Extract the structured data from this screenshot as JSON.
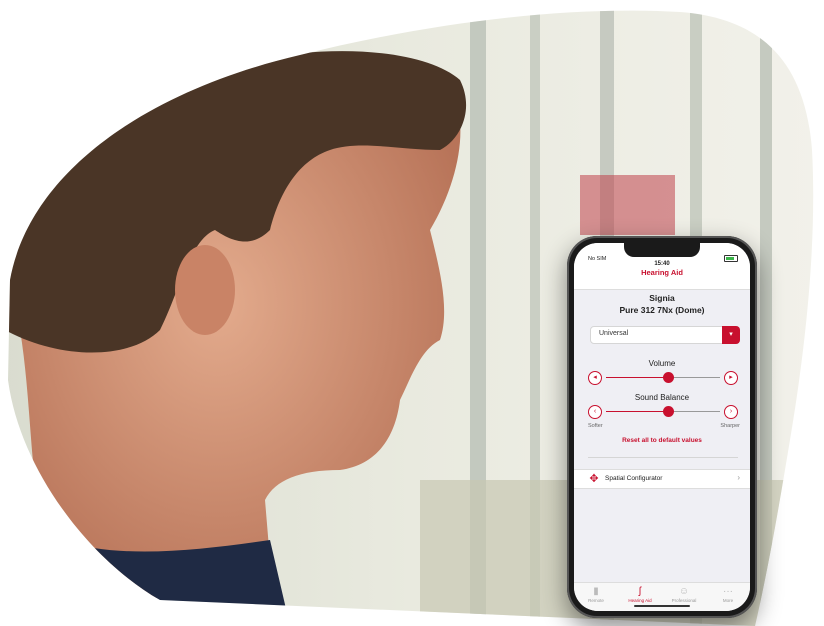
{
  "status": {
    "carrier": "No SIM",
    "time": "15:40"
  },
  "nav": {
    "title": "Hearing Aid"
  },
  "device": {
    "brand": "Signia",
    "model": "Pure 312 7Nx (Dome)"
  },
  "program": {
    "selected": "Universal"
  },
  "volume": {
    "label": "Volume",
    "level": 0.55
  },
  "sound_balance": {
    "label": "Sound Balance",
    "level": 0.55,
    "left_label": "Softer",
    "right_label": "Sharper"
  },
  "reset": {
    "label": "Reset all to default values"
  },
  "spatial": {
    "label": "Spatial Configurator"
  },
  "tabs": [
    {
      "label": "Remote",
      "icon": "bars-icon"
    },
    {
      "label": "Hearing Aid",
      "icon": "hearing-aid-icon",
      "active": true
    },
    {
      "label": "Professional",
      "icon": "person-icon"
    },
    {
      "label": "More",
      "icon": "dots-icon"
    }
  ],
  "colors": {
    "accent": "#c8102e"
  }
}
